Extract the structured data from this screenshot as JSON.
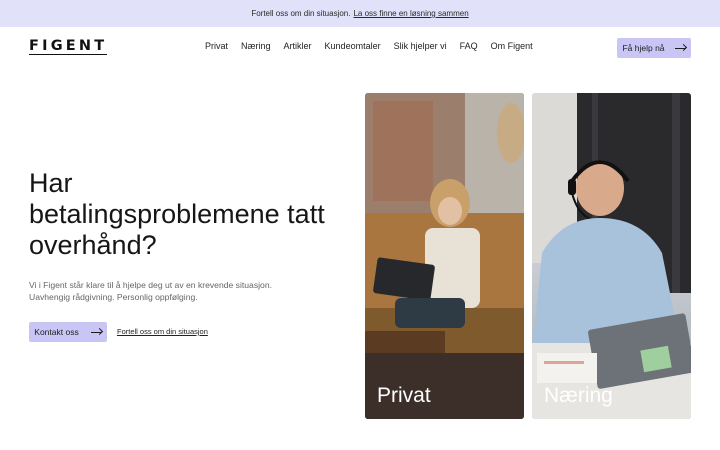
{
  "topbar": {
    "text": "Fortell oss om din situasjon.",
    "link": "La oss finne en løsning sammen"
  },
  "header": {
    "logo": "FIGENT",
    "nav": [
      "Privat",
      "Næring",
      "Artikler",
      "Kundeomtaler",
      "Slik hjelper vi",
      "FAQ",
      "Om Figent"
    ],
    "cta_label": "Få hjelp nå",
    "cta_icon": "arrow-right-icon"
  },
  "hero": {
    "title": "Har betalingsproblemene tatt overhånd?",
    "text": "Vi i Figent står klare til å hjelpe deg ut av en krevende situasjon. Uavhengig rådgivning. Personlig oppfølging.",
    "contact_label": "Kontakt oss",
    "contact_icon": "arrow-right-icon",
    "secondary_link": "Fortell oss om din situasjon"
  },
  "cards": [
    {
      "label": "Privat"
    },
    {
      "label": "Næring"
    }
  ],
  "colors": {
    "accent": "#c9c6f6",
    "topbar_bg": "#e1e1fa",
    "text": "#1c1c1c"
  }
}
